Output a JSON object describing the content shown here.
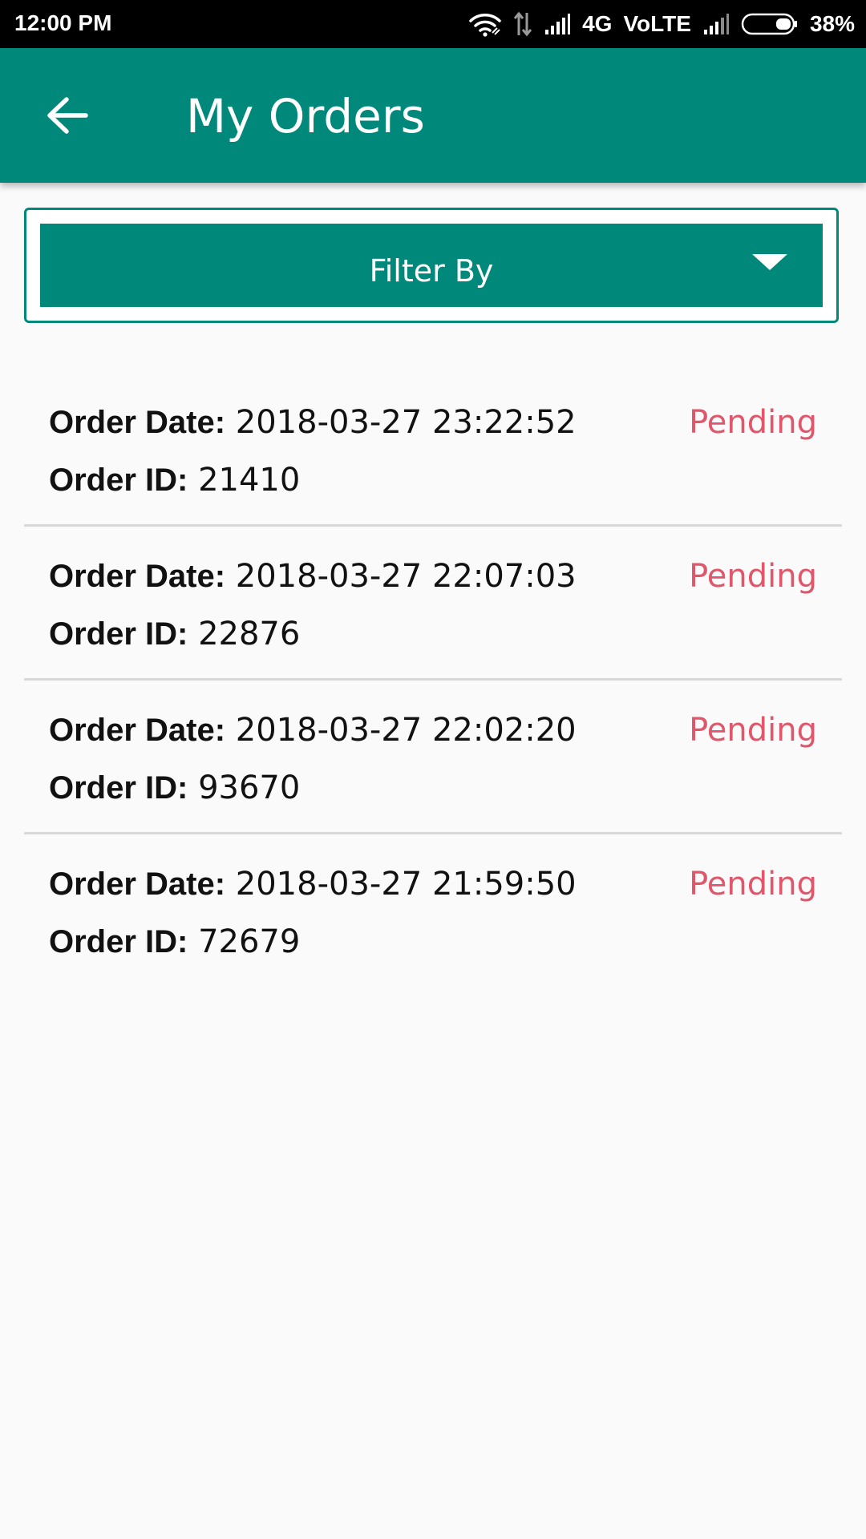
{
  "status_bar": {
    "time": "12:00 PM",
    "network_type": "4G",
    "volte": "VoLTE",
    "battery_percent": "38%",
    "icons": [
      "wifi-icon",
      "data-arrows-icon",
      "signal-icon",
      "signal-icon",
      "battery-icon"
    ]
  },
  "app_bar": {
    "title": "My Orders",
    "back_icon": "arrow-left-icon",
    "background_color": "#00897b"
  },
  "filter": {
    "label": "Filter By",
    "icon": "caret-down-icon"
  },
  "orders": [
    {
      "date_label": "Order Date:",
      "date": "2018-03-27 23:22:52",
      "id_label": "Order ID:",
      "id": "21410",
      "status": "Pending"
    },
    {
      "date_label": "Order Date:",
      "date": "2018-03-27 22:07:03",
      "id_label": "Order ID:",
      "id": "22876",
      "status": "Pending"
    },
    {
      "date_label": "Order Date:",
      "date": "2018-03-27 22:02:20",
      "id_label": "Order ID:",
      "id": "93670",
      "status": "Pending"
    },
    {
      "date_label": "Order Date:",
      "date": "2018-03-27 21:59:50",
      "id_label": "Order ID:",
      "id": "72679",
      "status": "Pending"
    }
  ],
  "colors": {
    "primary": "#00897b",
    "status_pending": "#e0566a",
    "background": "#fafafa"
  }
}
